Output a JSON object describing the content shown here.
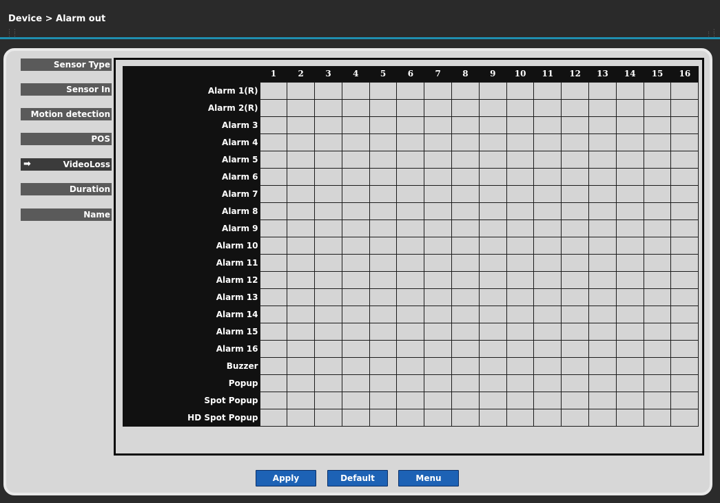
{
  "header": {
    "breadcrumb": "Device > Alarm out"
  },
  "sidebar": {
    "items": [
      {
        "label": "Sensor Type",
        "active": false
      },
      {
        "label": "Sensor In",
        "active": false
      },
      {
        "label": "Motion detection",
        "active": false
      },
      {
        "label": "POS",
        "active": false
      },
      {
        "label": "VideoLoss",
        "active": true
      },
      {
        "label": "Duration",
        "active": false
      },
      {
        "label": "Name",
        "active": false
      }
    ],
    "active_indicator_icon": "arrow-right-icon"
  },
  "grid": {
    "columns": [
      "1",
      "2",
      "3",
      "4",
      "5",
      "6",
      "7",
      "8",
      "9",
      "10",
      "11",
      "12",
      "13",
      "14",
      "15",
      "16"
    ],
    "rows": [
      "Alarm 1(R)",
      "Alarm 2(R)",
      "Alarm 3",
      "Alarm 4",
      "Alarm 5",
      "Alarm 6",
      "Alarm 7",
      "Alarm 8",
      "Alarm 9",
      "Alarm 10",
      "Alarm 11",
      "Alarm 12",
      "Alarm 13",
      "Alarm 14",
      "Alarm 15",
      "Alarm 16",
      "Buzzer",
      "Popup",
      "Spot Popup",
      "HD Spot Popup"
    ]
  },
  "buttons": {
    "apply": "Apply",
    "default": "Default",
    "menu": "Menu"
  },
  "colors": {
    "accent_line": "#1f8fb0",
    "button_blue": "#1d62b5",
    "grid_bg": "#111111",
    "cell": "#d5d5d5"
  }
}
